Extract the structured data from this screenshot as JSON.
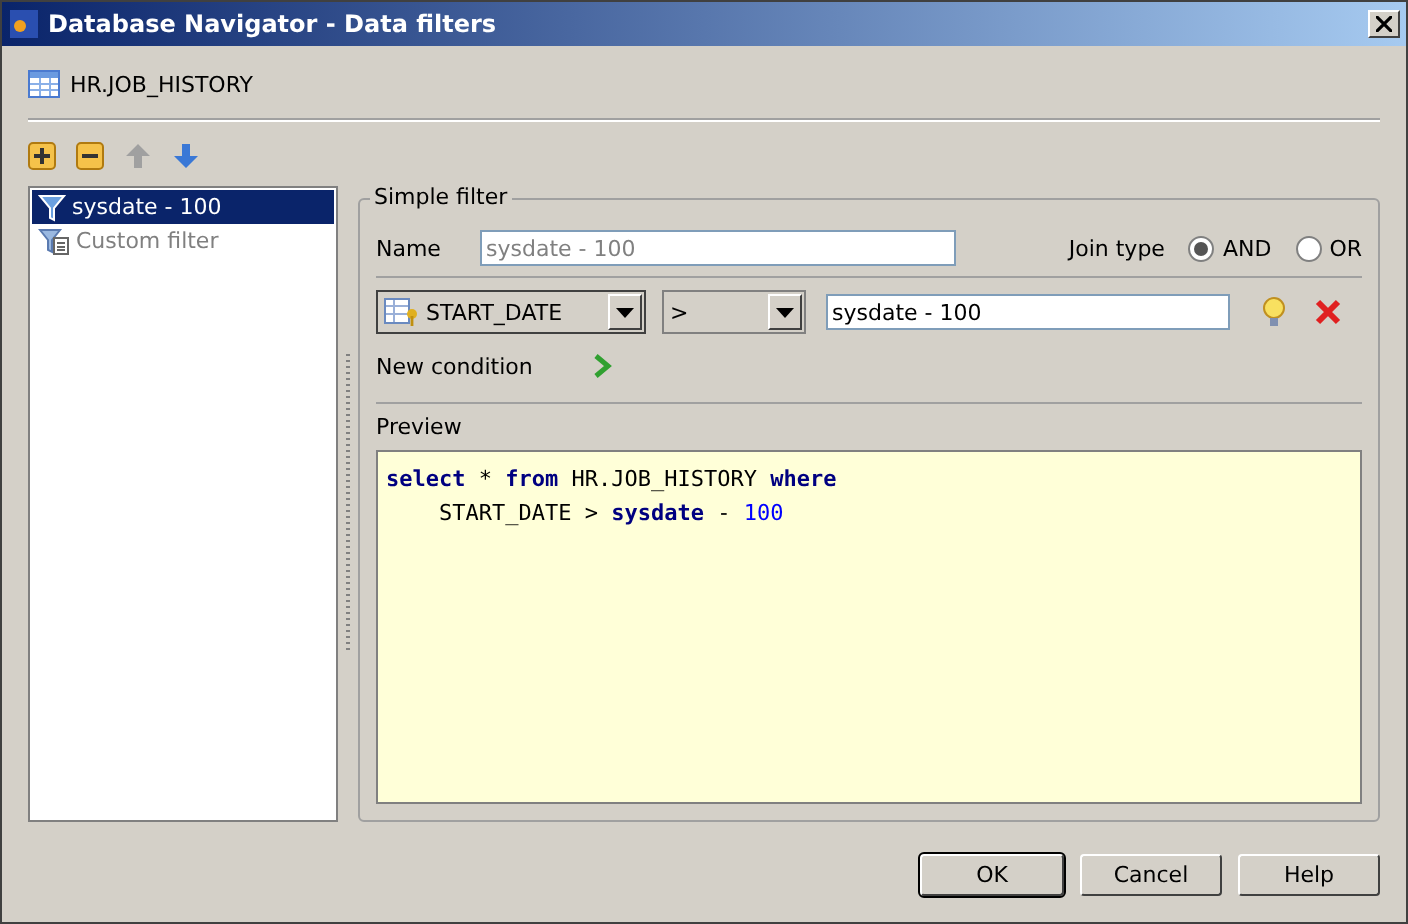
{
  "window": {
    "title": "Database Navigator - Data filters"
  },
  "object_name": "HR.JOB_HISTORY",
  "toolbar": [
    {
      "kind": "add",
      "disabled": false
    },
    {
      "kind": "remove",
      "disabled": false
    },
    {
      "kind": "up",
      "disabled": true
    },
    {
      "kind": "down",
      "disabled": false
    }
  ],
  "filters": [
    {
      "label": "sysdate - 100",
      "kind": "simple",
      "selected": true
    },
    {
      "label": "Custom filter",
      "kind": "custom",
      "selected": false
    }
  ],
  "simple_filter": {
    "title": "Simple filter",
    "name_label": "Name",
    "name_placeholder": "sysdate - 100",
    "join_label": "Join type",
    "join_options": [
      {
        "label": "AND",
        "selected": true
      },
      {
        "label": "OR",
        "selected": false
      }
    ],
    "condition": {
      "column": "START_DATE",
      "operator": ">",
      "value": "sysdate - 100"
    },
    "new_condition": "New condition"
  },
  "preview": {
    "title": "Preview",
    "lines": [
      [
        {
          "kind": "keyword",
          "text": "select"
        },
        {
          "kind": "plain",
          "text": " * "
        },
        {
          "kind": "keyword",
          "text": "from"
        },
        {
          "kind": "plain",
          "text": " HR.JOB_HISTORY "
        },
        {
          "kind": "keyword",
          "text": "where"
        }
      ],
      [
        {
          "kind": "plain",
          "text": "    START_DATE > "
        },
        {
          "kind": "keyword",
          "text": "sysdate"
        },
        {
          "kind": "plain",
          "text": " - "
        },
        {
          "kind": "number",
          "text": "100"
        }
      ]
    ]
  },
  "buttons": [
    {
      "label": "OK",
      "default": true
    },
    {
      "label": "Cancel",
      "default": false
    },
    {
      "label": "Help",
      "default": false
    }
  ]
}
